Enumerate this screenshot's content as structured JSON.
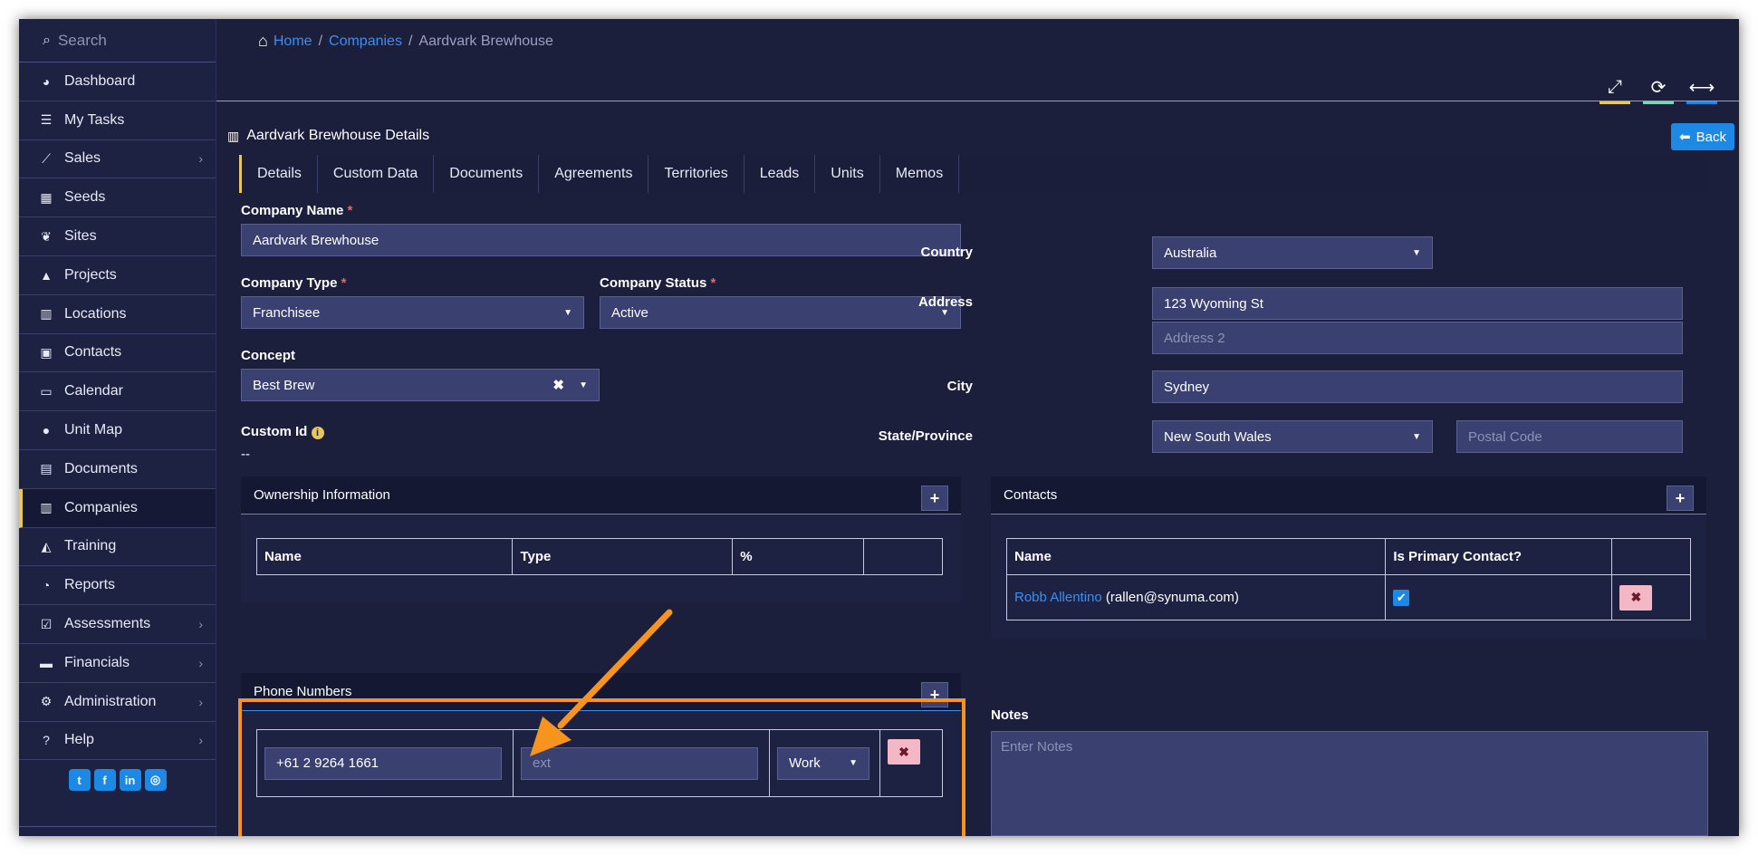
{
  "sidebar": {
    "search_placeholder": "Search",
    "items": [
      {
        "label": "Dashboard",
        "icon": "dashboard-icon",
        "glyph": "◕",
        "has_sub": false
      },
      {
        "label": "My Tasks",
        "icon": "tasks-icon",
        "glyph": "☰",
        "has_sub": false
      },
      {
        "label": "Sales",
        "icon": "chart-icon",
        "glyph": "⟋",
        "has_sub": true
      },
      {
        "label": "Seeds",
        "icon": "grid-icon",
        "glyph": "▦",
        "has_sub": false
      },
      {
        "label": "Sites",
        "icon": "leaf-icon",
        "glyph": "❦",
        "has_sub": false
      },
      {
        "label": "Projects",
        "icon": "projects-icon",
        "glyph": "▲",
        "has_sub": false
      },
      {
        "label": "Locations",
        "icon": "building-icon",
        "glyph": "▥",
        "has_sub": false
      },
      {
        "label": "Contacts",
        "icon": "contact-card-icon",
        "glyph": "▣",
        "has_sub": false
      },
      {
        "label": "Calendar",
        "icon": "calendar-icon",
        "glyph": "▭",
        "has_sub": false
      },
      {
        "label": "Unit Map",
        "icon": "globe-icon",
        "glyph": "●",
        "has_sub": false
      },
      {
        "label": "Documents",
        "icon": "document-icon",
        "glyph": "▤",
        "has_sub": false
      },
      {
        "label": "Companies",
        "icon": "building-icon",
        "glyph": "▥",
        "has_sub": false,
        "active": true
      },
      {
        "label": "Training",
        "icon": "graduation-cap-icon",
        "glyph": "◭",
        "has_sub": false
      },
      {
        "label": "Reports",
        "icon": "pie-chart-icon",
        "glyph": "◔",
        "has_sub": false
      },
      {
        "label": "Assessments",
        "icon": "check-square-icon",
        "glyph": "☑",
        "has_sub": true
      },
      {
        "label": "Financials",
        "icon": "money-icon",
        "glyph": "▬",
        "has_sub": true
      },
      {
        "label": "Administration",
        "icon": "cogs-icon",
        "glyph": "⚙",
        "has_sub": true
      },
      {
        "label": "Help",
        "icon": "question-icon",
        "glyph": "?",
        "has_sub": true
      }
    ],
    "social": [
      "t",
      "f",
      "in",
      "◎"
    ]
  },
  "breadcrumb": {
    "home": "Home",
    "companies": "Companies",
    "current": "Aardvark Brewhouse"
  },
  "panel": {
    "title": "Aardvark Brewhouse Details",
    "back": "Back"
  },
  "tabs": [
    "Details",
    "Custom Data",
    "Documents",
    "Agreements",
    "Territories",
    "Leads",
    "Units",
    "Memos"
  ],
  "form": {
    "company_name_label": "Company Name",
    "company_name": "Aardvark Brewhouse",
    "company_type_label": "Company Type",
    "company_type": "Franchisee",
    "company_status_label": "Company Status",
    "company_status": "Active",
    "concept_label": "Concept",
    "concept": "Best Brew",
    "custom_id_label": "Custom Id",
    "custom_id": "--",
    "country_label": "Country",
    "country": "Australia",
    "address_label": "Address",
    "address1": "123 Wyoming St",
    "address2_placeholder": "Address 2",
    "city_label": "City",
    "city": "Sydney",
    "state_label": "State/Province",
    "state": "New South Wales",
    "postal_placeholder": "Postal Code",
    "notes_label": "Notes",
    "notes_placeholder": "Enter Notes"
  },
  "ownership": {
    "title": "Ownership Information",
    "columns": [
      "Name",
      "Type",
      "%",
      ""
    ]
  },
  "contacts": {
    "title": "Contacts",
    "columns": [
      "Name",
      "Is Primary Contact?",
      ""
    ],
    "rows": [
      {
        "name": "Robb Allentino",
        "email": "(rallen@synuma.com)",
        "primary": true
      }
    ]
  },
  "phones": {
    "title": "Phone Numbers",
    "number": "+61 2 9264 1661",
    "ext_placeholder": "ext",
    "type": "Work"
  },
  "colors": {
    "accent": "#f7941d",
    "link": "#3d8ef0",
    "bg": "#1b1f3b"
  }
}
